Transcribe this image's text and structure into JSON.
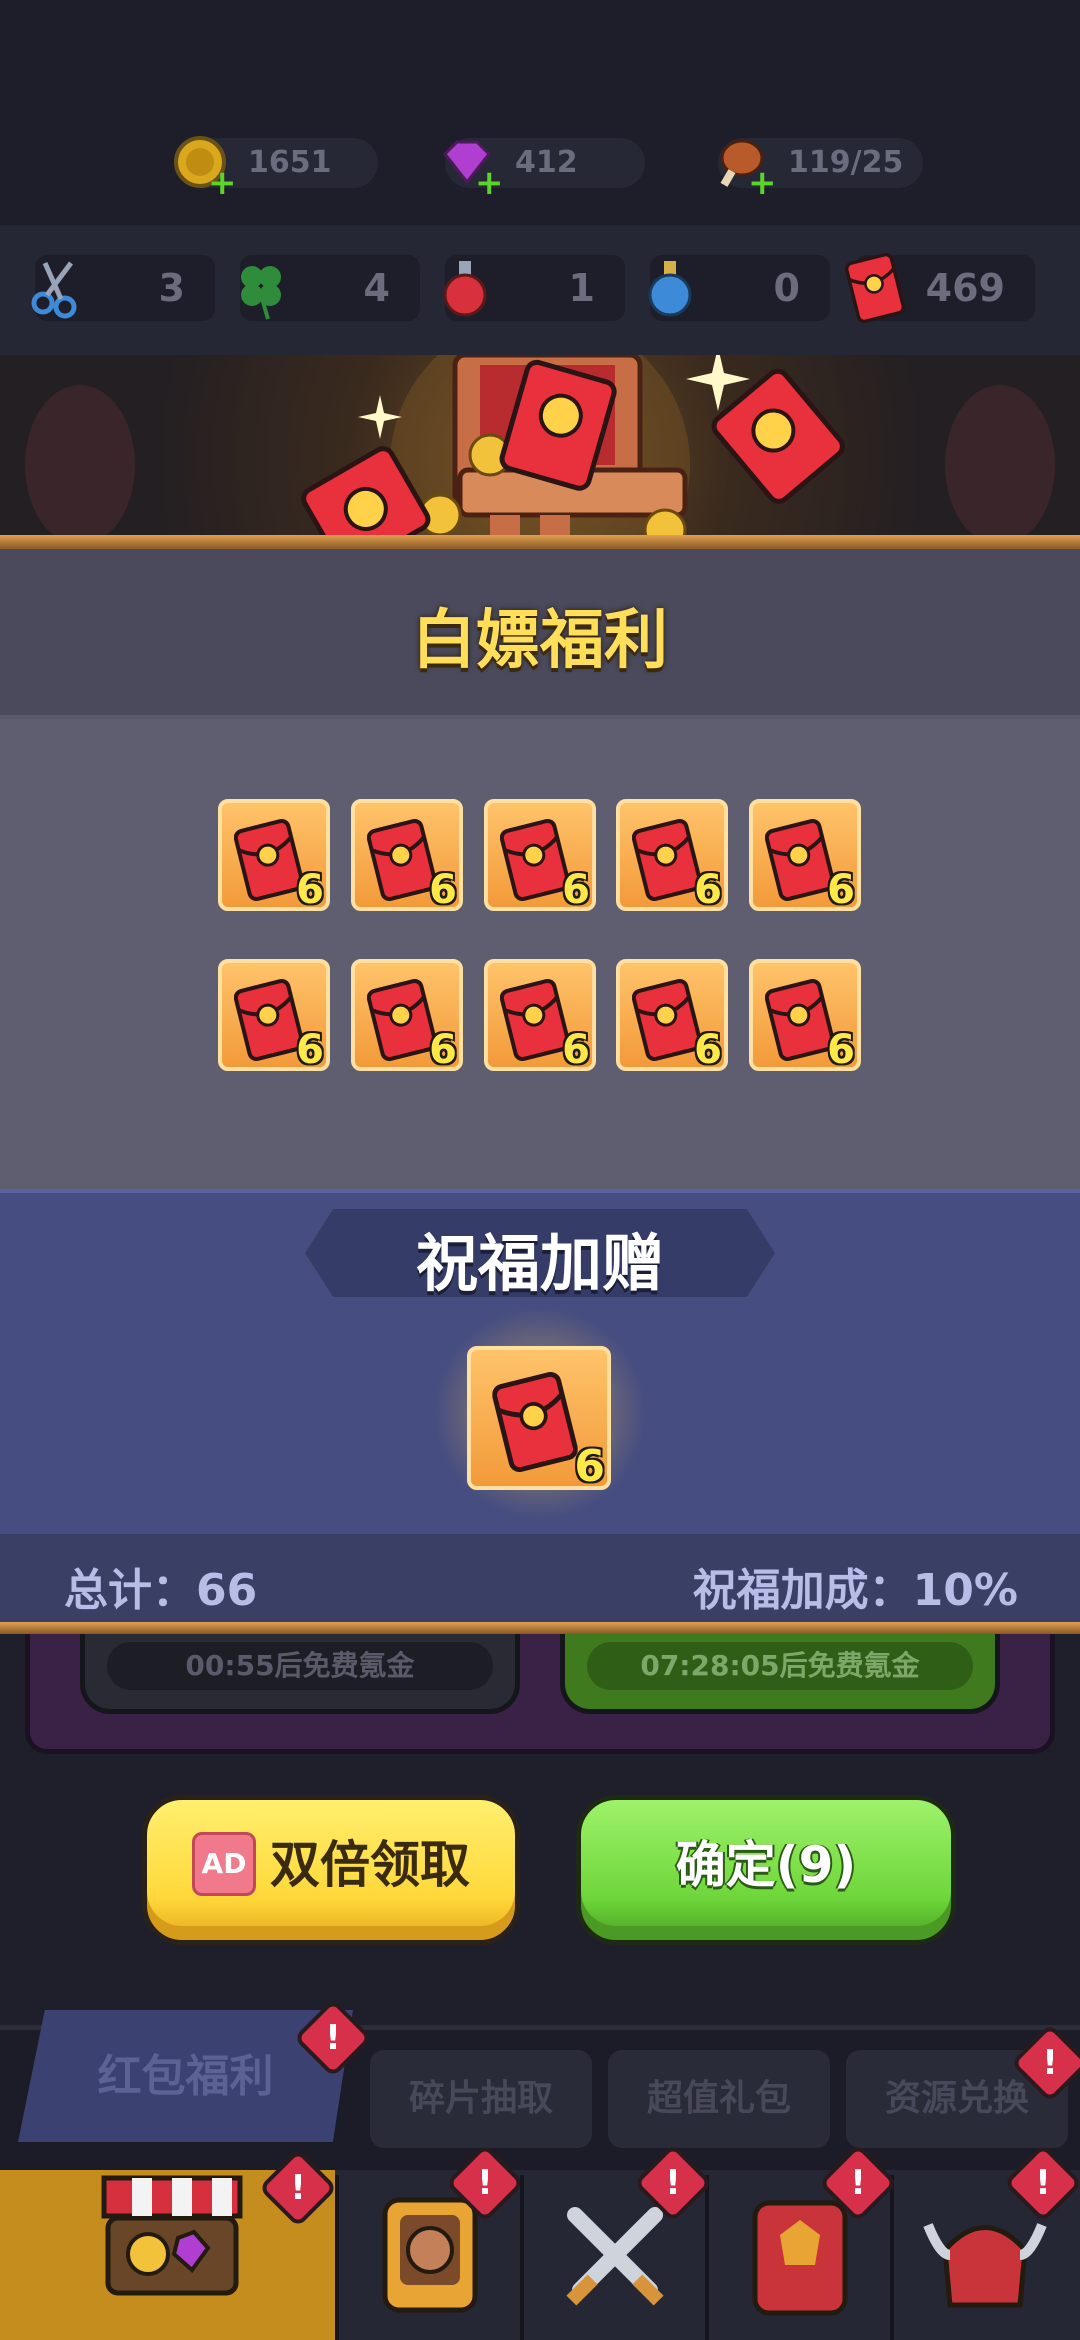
{
  "currencies": [
    {
      "name": "gold-coin",
      "value": "1651"
    },
    {
      "name": "gem",
      "value": "412"
    },
    {
      "name": "meat",
      "value": "119/25"
    }
  ],
  "resources": [
    {
      "name": "scissors",
      "value": "3"
    },
    {
      "name": "clover",
      "value": "4"
    },
    {
      "name": "red-potion",
      "value": "1"
    },
    {
      "name": "blue-potion",
      "value": "0"
    },
    {
      "name": "red-envelope",
      "value": "469"
    }
  ],
  "modal": {
    "title": "白嫖福利",
    "rewards": [
      {
        "icon": "red-envelope-icon",
        "count": "6"
      },
      {
        "icon": "red-envelope-icon",
        "count": "6"
      },
      {
        "icon": "red-envelope-icon",
        "count": "6"
      },
      {
        "icon": "red-envelope-icon",
        "count": "6"
      },
      {
        "icon": "red-envelope-icon",
        "count": "6"
      },
      {
        "icon": "red-envelope-icon",
        "count": "6"
      },
      {
        "icon": "red-envelope-icon",
        "count": "6"
      },
      {
        "icon": "red-envelope-icon",
        "count": "6"
      },
      {
        "icon": "red-envelope-icon",
        "count": "6"
      },
      {
        "icon": "red-envelope-icon",
        "count": "6"
      }
    ],
    "bonus_title": "祝福加赠",
    "bonus_reward": {
      "icon": "red-envelope-icon",
      "count": "6"
    },
    "total_label": "总计：66",
    "bonus_rate_label": "祝福加成：10%"
  },
  "timers": [
    "00:55后免费氪金",
    "07:28:05后免费氪金"
  ],
  "buttons": {
    "ad_badge": "AD",
    "double_claim": "双倍领取",
    "confirm": "确定(9)"
  },
  "tabs": [
    "红包福利",
    "碎片抽取",
    "超值礼包",
    "资源兑换"
  ],
  "alert_glyph": "!",
  "colors": {
    "title_yellow": "#ffde5a",
    "envelope_red": "#e8313c",
    "card_orange": "#f5a447",
    "confirm_green": "#6ed63a",
    "double_yellow": "#ffd83a"
  }
}
